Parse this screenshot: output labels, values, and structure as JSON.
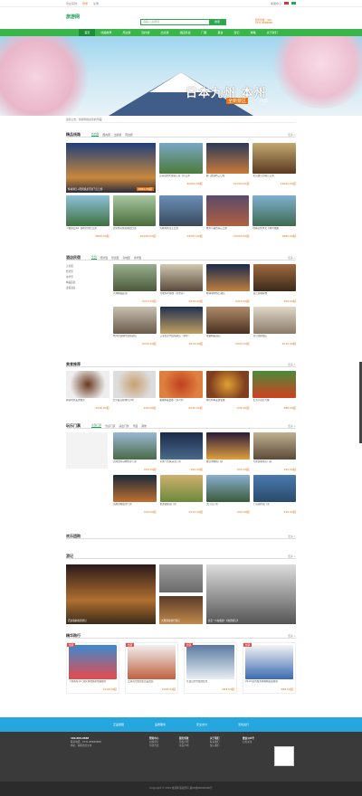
{
  "topbar": {
    "left": "欢迎来到",
    "login": "登录",
    "reg": "注册",
    "right": "客服中心"
  },
  "header": {
    "logo": "旅游网",
    "search_placeholder": "请输入关键词",
    "search_btn": "搜索",
    "hotline_1": "服务热线：400-",
    "hotline_2": "0731-8888888"
  },
  "nav": [
    "首页",
    "线路推荐",
    "周边游",
    "国内游",
    "出境游",
    "酒店民宿",
    "门票",
    "美食",
    "游记",
    "攻略",
    "关于我们"
  ],
  "banner": {
    "title": "日本九州  本州",
    "tag": "全新景区",
    "days": "六日"
  },
  "notice": "最新公告：旅游网欢迎您的光临！",
  "sections": {
    "lines": {
      "title": "精品线路",
      "tabs": [
        "省内游",
        "国内游",
        "出境游",
        "周边游"
      ],
      "more": "更多 >"
    },
    "hotel": {
      "title": "酒店民宿",
      "tabs": [
        "全部",
        "经济型",
        "舒适型",
        "高档型",
        "豪华型"
      ],
      "more": "更多 >"
    },
    "food": {
      "title": "美食推荐",
      "more": "更多 >"
    },
    "tickets": {
      "title": "玩乐门票",
      "tabs": [
        "全部门票",
        "景点门票",
        "演出门票",
        "乐园",
        "其他"
      ],
      "more": "更多 >"
    },
    "group": {
      "title": "欢乐团购",
      "more": "更多 >"
    },
    "notes": {
      "title": "游记",
      "more": "更多 >"
    },
    "gift": {
      "title": "精华购行",
      "more": "更多 >"
    }
  },
  "line_cards": [
    {
      "cap": "桂林漓江+阳朔遇龙河双飞五日游",
      "price": "¥980.00起"
    },
    {
      "cap": "云南昆明大理丽江双飞六日游",
      "price": "¥2000.00起"
    },
    {
      "cap": "厦门鼓浪屿三日游",
      "price": "¥2000.00起"
    },
    {
      "cap": "北京故宫长城五日游",
      "price": "¥2000.00起"
    },
    {
      "cap": "【邂逅云南】昆明大理六日游",
      "price": "¥828.00起"
    },
    {
      "cap": "张家界凤凰古城四日游",
      "price": "¥2000.00起"
    },
    {
      "cap": "九寨沟黄龙五日游",
      "price": "¥2087.00起"
    },
    {
      "cap": "杭州乌镇西湖三日游",
      "price": "¥2000.00起"
    },
    {
      "cap": "桂林山水甲天下特价线路",
      "price": "¥680.00起"
    }
  ],
  "hotel_side": [
    "五星级",
    "经济型",
    "豪华型",
    "精品民宿",
    "度假酒店"
  ],
  "hotel_cards": [
    {
      "cap": "大理精品民宿",
      "price": "¥210.00起"
    },
    {
      "cap": "西塘水乡客栈（河景房）",
      "price": "¥216.00起"
    },
    {
      "cap": "桂林城市假日酒店",
      "price": "¥316.00起"
    },
    {
      "cap": "丽江古城客栈",
      "price": "¥56.00起"
    },
    {
      "cap": "杭州西湖湖景度假酒店",
      "price": "¥230.00起"
    },
    {
      "cap": "三亚亚龙湾度假酒店（豪华）",
      "price": "¥216.00起"
    },
    {
      "cap": "成都精品酒店",
      "price": "¥340.00起"
    },
    {
      "cap": "北京国际饭店",
      "price": "¥216.00起"
    }
  ],
  "food_cards": [
    {
      "cap": "湖南特色美食推荐",
      "price": "¥348.00起"
    },
    {
      "cap": "长沙臭豆腐特色小吃",
      "price": "¥36.00起"
    },
    {
      "cap": "湘菜精品套餐（双人份）",
      "price": "¥230.00起"
    },
    {
      "cap": "特色烤串美食套餐",
      "price": "¥36.00起"
    },
    {
      "cap": "长沙小龙虾大餐",
      "price": "¥88.00起"
    }
  ],
  "ticket_cards": [
    {
      "cap": "长隆野生动物世界门票",
      "price": "¥90.00起"
    },
    {
      "cap": "宋城千古情演出门票",
      "price": "¥90.00起"
    },
    {
      "cap": "故宫博物院门票",
      "price": "¥90.00起"
    },
    {
      "cap": "大理古城景区门票",
      "price": "¥90.00起"
    },
    {
      "cap": "凤凰古城夜景门票",
      "price": "¥30.00起"
    },
    {
      "cap": "婺源油菜花门票",
      "price": "¥110.00起"
    },
    {
      "cap": "天门山门票",
      "price": "¥90.00起"
    },
    {
      "cap": "千岛湖景区门票",
      "price": "¥30.00起"
    }
  ],
  "notes": [
    {
      "cap": "西双版纳旅游游记"
    },
    {
      "cap": "大理洱海骑行游记"
    },
    {
      "cap": "古镇游记"
    },
    {
      "cap": "北京 \"人在旅途\"【旅游游记】"
    }
  ],
  "gift_cards": [
    {
      "badge": "热销",
      "cap": "【游客专享】国庆特惠旅游线路推荐",
      "price": "¥128.00起"
    },
    {
      "badge": "热销",
      "cap": "云南风光旅游纪念品套装",
      "price": "¥198.00起"
    },
    {
      "badge": "热销",
      "cap": "长白山雪景旅游套票",
      "price": "¥68.00起"
    },
    {
      "badge": "热销",
      "cap": "2019 最新旅游攻略精装版图书",
      "price": "¥88.00起"
    }
  ],
  "footbar": [
    "正品保障",
    "品质服务",
    "安全支付",
    "无忧出行"
  ],
  "footer": {
    "c1": {
      "h": "400-888-8888",
      "a": "联系电话：0731-88888888",
      "b": "地址：湖南省长沙市"
    },
    "c2": {
      "h": "帮助中心",
      "a": "如何预订",
      "b": "付款方式"
    },
    "c3": {
      "h": "服务条款",
      "a": "隐私声明",
      "b": "免责声明"
    },
    "c4": {
      "h": "关于我们",
      "a": "联系我们",
      "b": "加入我们"
    },
    "c5": {
      "h": "微信公众号",
      "a": "扫码关注"
    }
  },
  "copyright": "Copyright © 2019 旅游网 版权所有 湘ICP备00000000号"
}
